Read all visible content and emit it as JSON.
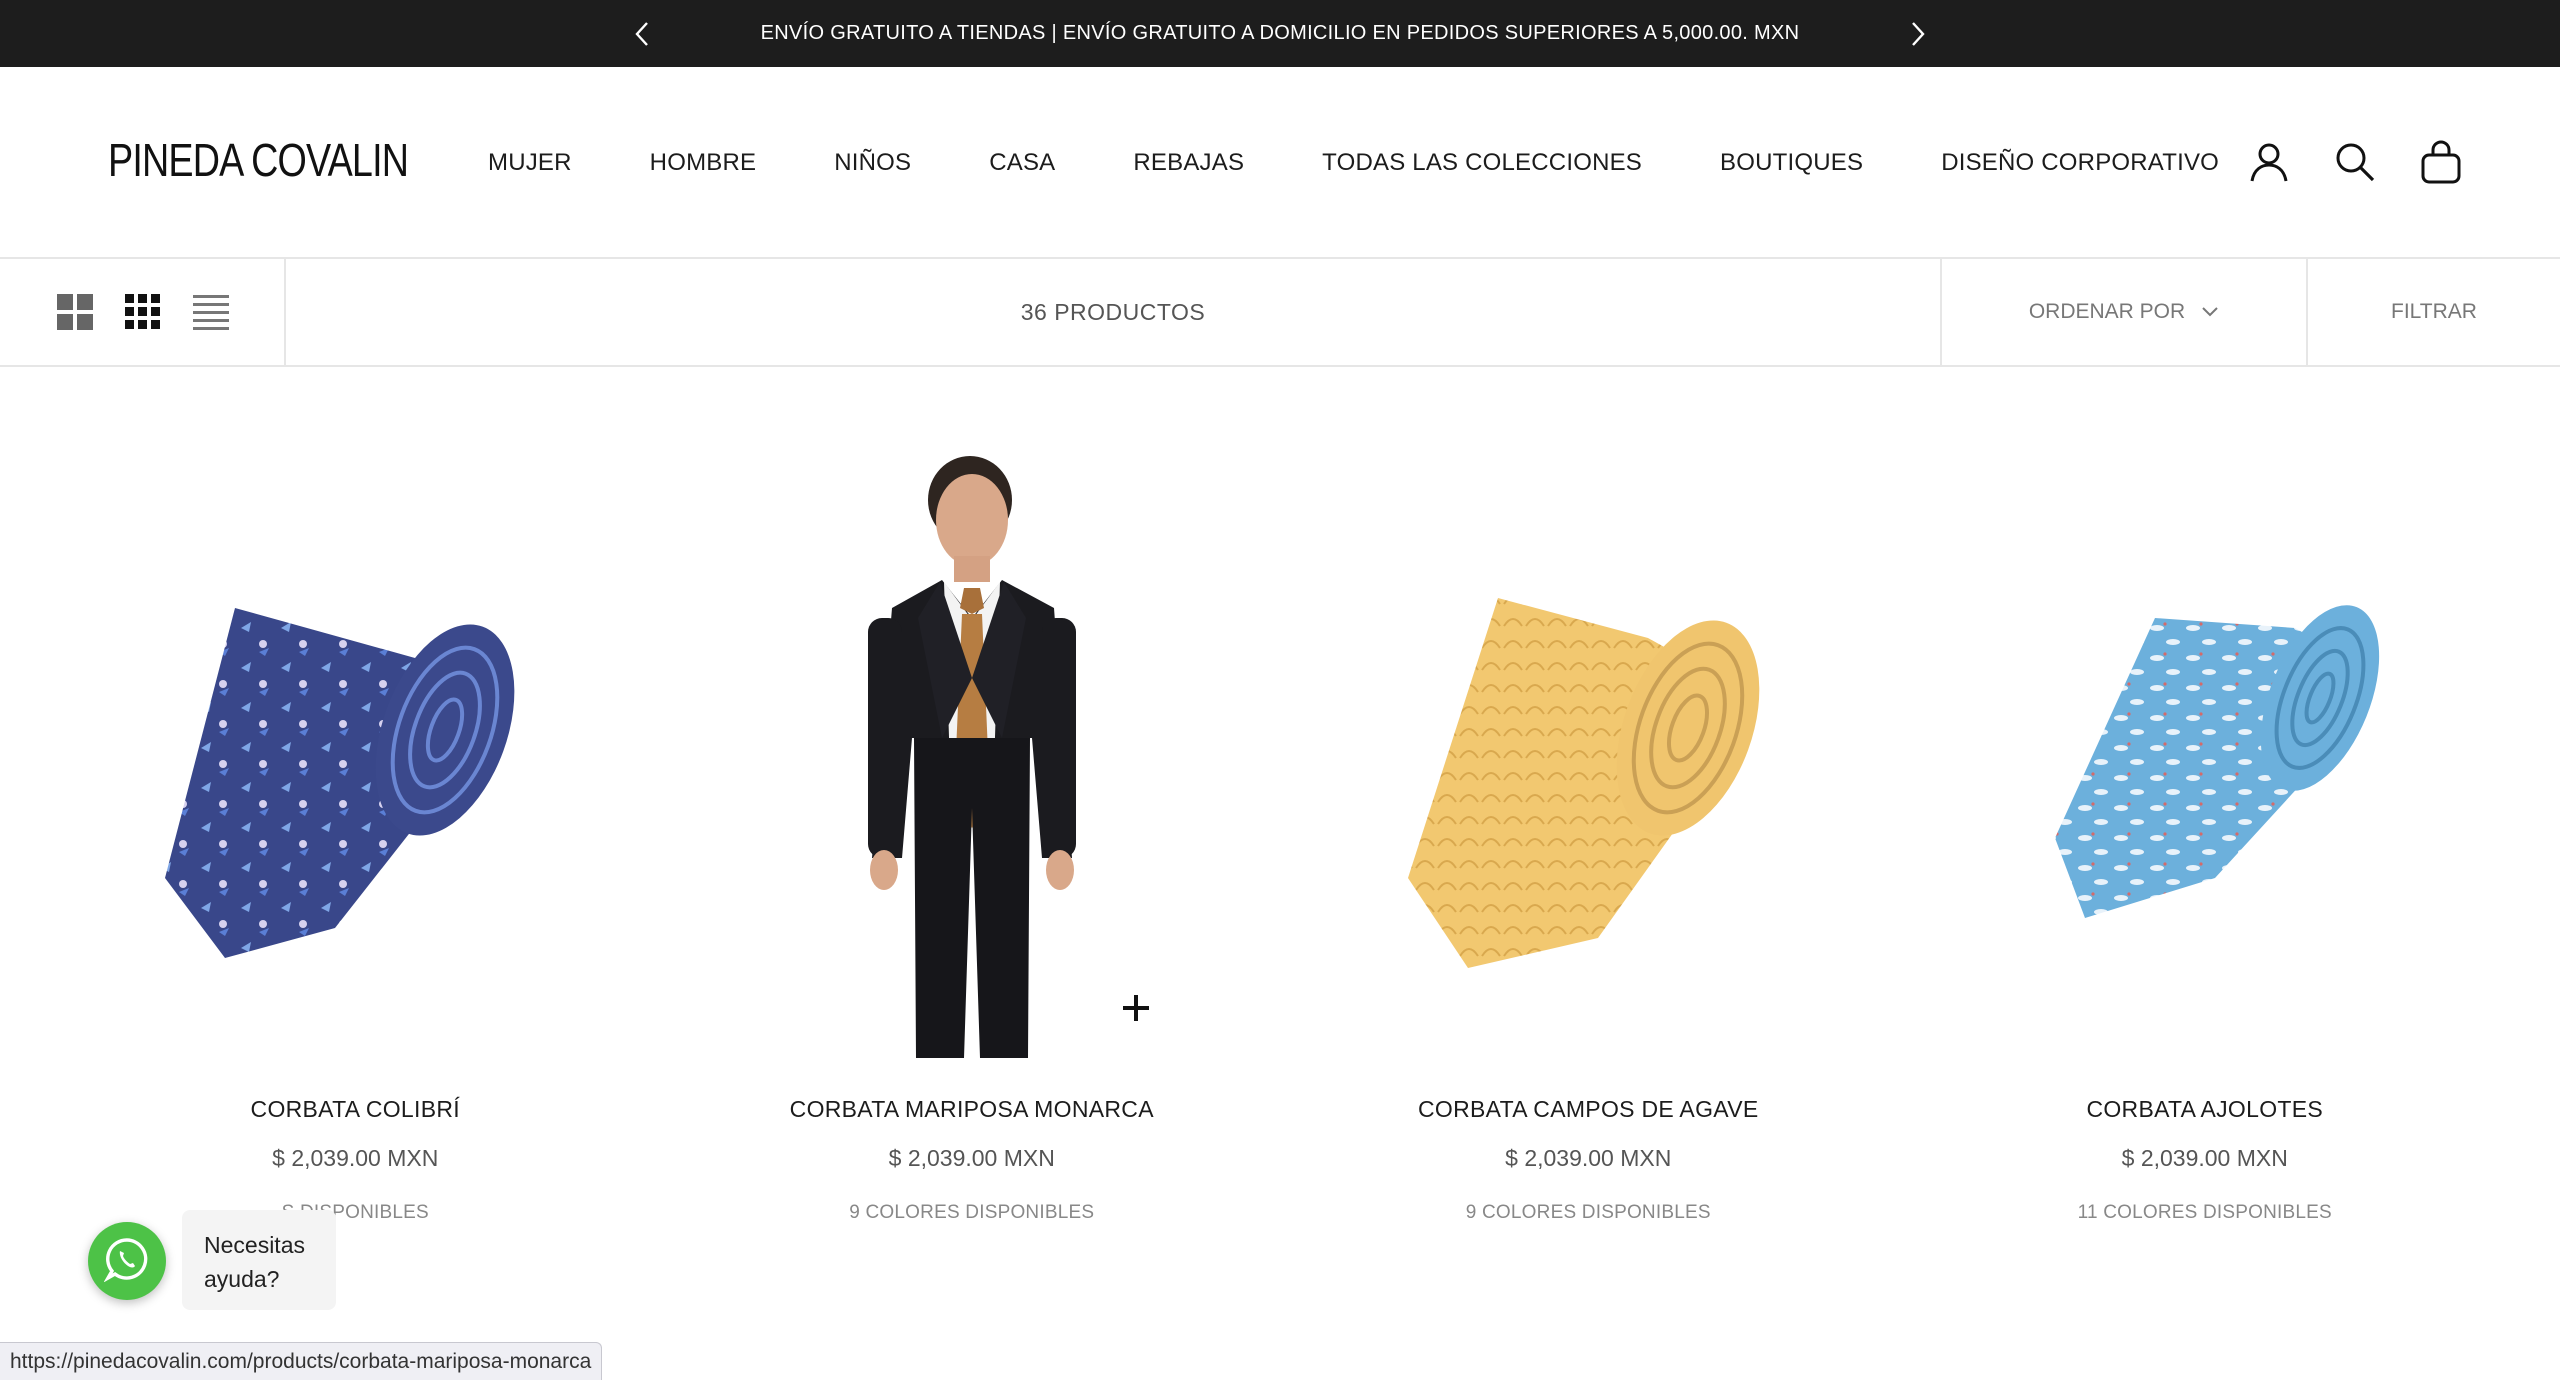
{
  "announcement": {
    "text": "ENVÍO GRATUITO A TIENDAS | ENVÍO GRATUITO A DOMICILIO EN PEDIDOS SUPERIORES A 5,000.00. MXN",
    "prev_icon": "chevron-left-icon",
    "next_icon": "chevron-right-icon"
  },
  "header": {
    "logo": "PINEDA COVALIN",
    "nav": [
      "MUJER",
      "HOMBRE",
      "NIÑOS",
      "CASA",
      "REBAJAS",
      "TODAS LAS COLECCIONES",
      "BOUTIQUES",
      "DISEÑO CORPORATIVO"
    ],
    "icons": [
      "account-icon",
      "search-icon",
      "cart-bag-icon"
    ]
  },
  "toolbar": {
    "view_modes": [
      "grid-large-icon",
      "grid-small-icon",
      "list-icon"
    ],
    "product_count": "36 PRODUCTOS",
    "sort_label": "ORDENAR POR",
    "filter_label": "FILTRAR"
  },
  "products": [
    {
      "title": "CORBATA COLIBRÍ",
      "price": "$ 2,039.00 MXN",
      "colors": "S DISPONIBLES",
      "tie_color": "#3a4a8a",
      "pattern_color": "#7fa6e6"
    },
    {
      "title": "CORBATA MARIPOSA MONARCA",
      "price": "$ 2,039.00 MXN",
      "colors": "9 COLORES DISPONIBLES",
      "tie_color": "#a8703a",
      "pattern_color": "#e2b07a"
    },
    {
      "title": "CORBATA CAMPOS DE AGAVE",
      "price": "$ 2,039.00 MXN",
      "colors": "9 COLORES DISPONIBLES",
      "tie_color": "#f0c56e",
      "pattern_color": "#d9a84e"
    },
    {
      "title": "CORBATA AJOLOTES",
      "price": "$ 2,039.00 MXN",
      "colors": "11 COLORES DISPONIBLES",
      "tie_color": "#6cb0dc",
      "pattern_color": "#e8f2fa"
    }
  ],
  "whatsapp": {
    "text": "Necesitas ayuda?",
    "color": "#4dc247"
  },
  "status_url": "https://pinedacovalin.com/products/corbata-mariposa-monarca"
}
